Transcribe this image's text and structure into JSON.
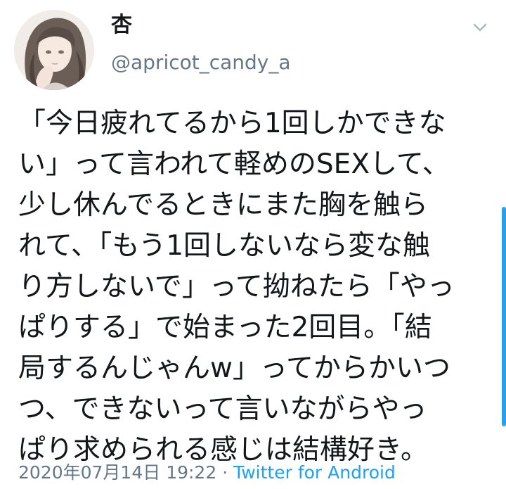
{
  "user": {
    "display_name": "杏",
    "handle": "@apricot_candy_a"
  },
  "icons": {
    "menu": "chevron-down-icon"
  },
  "tweet": {
    "lines": [
      "「今日疲れてるから1回しかできな",
      "い」って言われて軽めのSEXして、",
      "少し休んでるときにまた胸を触ら",
      "れて、「もう1回しないなら変な触",
      "り方しないで」って拗ねたら「やっ",
      "ぱりする」で始まった2回目。「結",
      "局するんじゃんw」ってからかいつ",
      "つ、できないって言いながらやっ",
      "ぱり求められる感じは結構好き。"
    ],
    "timestamp": "2020年07月14日 19:22",
    "separator": " · ",
    "source": "Twitter for Android"
  },
  "colors": {
    "text": "#14171a",
    "secondary": "#657786",
    "link": "#1da1f2",
    "scrollbar": "#2c9fe8"
  }
}
